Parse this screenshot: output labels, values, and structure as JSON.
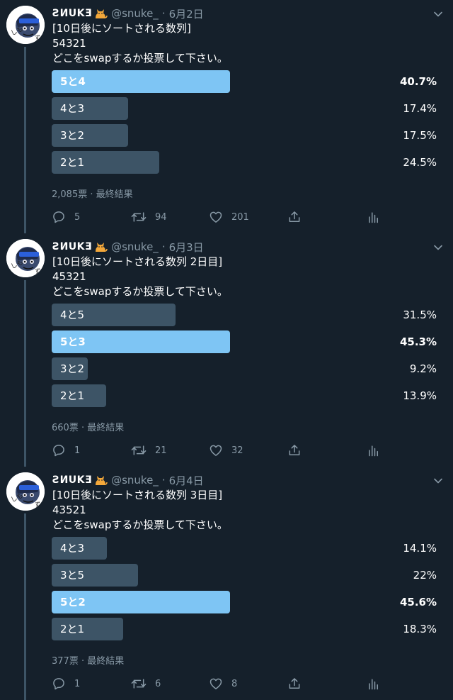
{
  "tweets": [
    {
      "display_name": "ꙄИUKƎ",
      "handle": "@snuke_",
      "dot": "·",
      "date": "6月2日",
      "lines": [
        "[10日後にソートされる数列]",
        "54321",
        "どこをswapするか投票して下さい。"
      ],
      "poll": {
        "options": [
          {
            "label": "5と4",
            "percent": "40.7%",
            "value": 40.7,
            "winner": true
          },
          {
            "label": "4と3",
            "percent": "17.4%",
            "value": 17.4,
            "winner": false
          },
          {
            "label": "3と2",
            "percent": "17.5%",
            "value": 17.5,
            "winner": false
          },
          {
            "label": "2と1",
            "percent": "24.5%",
            "value": 24.5,
            "winner": false
          }
        ],
        "meta": "2,085票 · 最終結果"
      },
      "counts": {
        "reply": "5",
        "retweet": "94",
        "like": "201"
      }
    },
    {
      "display_name": "ꙄИUKƎ",
      "handle": "@snuke_",
      "dot": "·",
      "date": "6月3日",
      "lines": [
        "[10日後にソートされる数列 2日目]",
        "45321",
        "どこをswapするか投票して下さい。"
      ],
      "poll": {
        "options": [
          {
            "label": "4と5",
            "percent": "31.5%",
            "value": 31.5,
            "winner": false
          },
          {
            "label": "5と3",
            "percent": "45.3%",
            "value": 45.3,
            "winner": true
          },
          {
            "label": "3と2",
            "percent": "9.2%",
            "value": 9.2,
            "winner": false
          },
          {
            "label": "2と1",
            "percent": "13.9%",
            "value": 13.9,
            "winner": false
          }
        ],
        "meta": "660票 · 最終結果"
      },
      "counts": {
        "reply": "1",
        "retweet": "21",
        "like": "32"
      }
    },
    {
      "display_name": "ꙄИUKƎ",
      "handle": "@snuke_",
      "dot": "·",
      "date": "6月4日",
      "lines": [
        "[10日後にソートされる数列 3日目]",
        "43521",
        "どこをswapするか投票して下さい。"
      ],
      "poll": {
        "options": [
          {
            "label": "4と3",
            "percent": "14.1%",
            "value": 14.1,
            "winner": false
          },
          {
            "label": "3と5",
            "percent": "22%",
            "value": 22,
            "winner": false
          },
          {
            "label": "5と2",
            "percent": "45.6%",
            "value": 45.6,
            "winner": true
          },
          {
            "label": "2と1",
            "percent": "18.3%",
            "value": 18.3,
            "winner": false
          }
        ],
        "meta": "377票 · 最終結果"
      },
      "counts": {
        "reply": "1",
        "retweet": "6",
        "like": "8"
      }
    }
  ],
  "colors": {
    "background": "#15202b",
    "bar": "#3d5466",
    "winner_bar": "#7ec5f4",
    "muted_text": "#8899a6"
  },
  "icons": [
    "cat-emoji-icon",
    "chevron-down-icon",
    "reply-icon",
    "retweet-icon",
    "like-icon",
    "share-icon",
    "analytics-icon"
  ]
}
